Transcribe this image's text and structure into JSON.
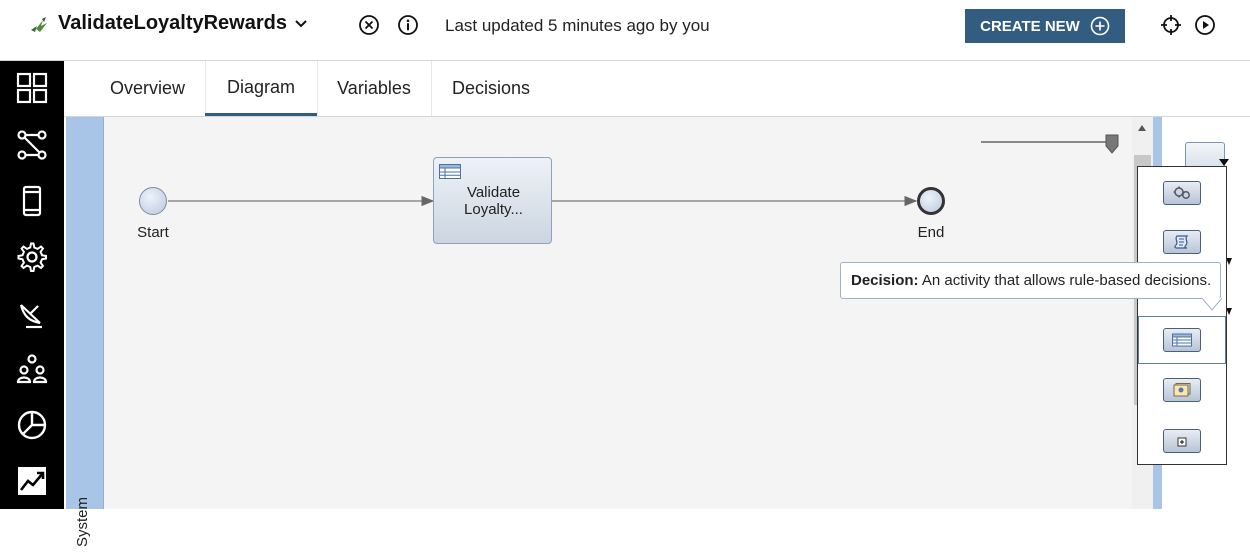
{
  "header": {
    "app_title": "ValidateLoyaltyRewards",
    "status": "Last updated 5 minutes ago by you",
    "create_label": "CREATE NEW"
  },
  "tabs": [
    {
      "label": "Overview",
      "active": false
    },
    {
      "label": "Diagram",
      "active": true
    },
    {
      "label": "Variables",
      "active": false
    },
    {
      "label": "Decisions",
      "active": false
    }
  ],
  "nav": [
    {
      "icon": "dashboard-icon"
    },
    {
      "icon": "process-flow-icon"
    },
    {
      "icon": "mobile-device-icon"
    },
    {
      "icon": "settings-gear-icon"
    },
    {
      "icon": "satellite-dish-icon"
    },
    {
      "icon": "team-users-icon"
    },
    {
      "icon": "pie-chart-icon"
    },
    {
      "icon": "trend-chart-icon"
    }
  ],
  "diagram": {
    "lane": "System",
    "start_label": "Start",
    "task_label_line1": "Validate",
    "task_label_line2": "Loyalty...",
    "end_label": "End"
  },
  "tooltip": {
    "term": "Decision:",
    "description": "An activity that allows rule-based decisions."
  },
  "palette": [
    {
      "icon": "service-activity-icon"
    },
    {
      "icon": "script-activity-icon"
    },
    {
      "icon": "decision-activity-icon",
      "selected": true
    },
    {
      "icon": "user-task-icon"
    },
    {
      "icon": "subprocess-icon"
    }
  ],
  "colors": {
    "accent": "#325c80",
    "lane": "#a8c4e6",
    "nav_bg": "#000000",
    "canvas_bg": "#f4f4f4"
  }
}
